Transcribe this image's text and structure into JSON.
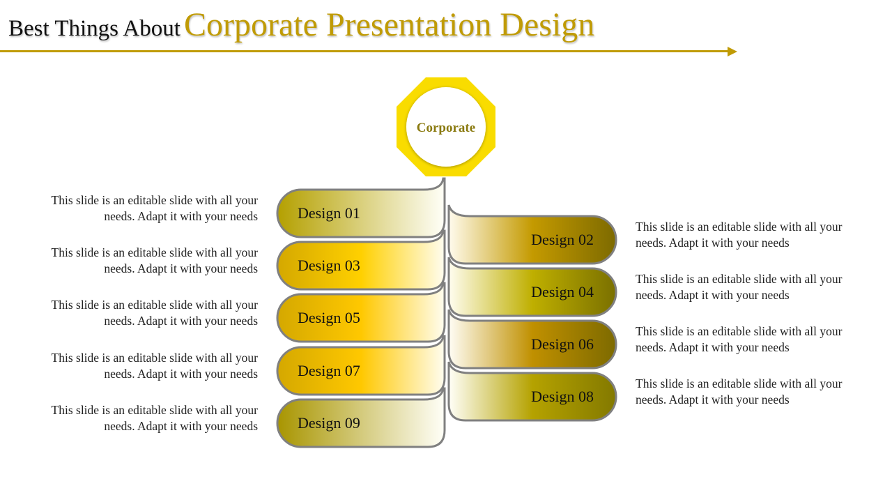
{
  "title": {
    "prefix": "Best Things About",
    "highlight": "Corporate Presentation Design"
  },
  "hub": {
    "label": "Corporate",
    "color": "#F9DC00"
  },
  "colors": {
    "accent": "#C09B05",
    "outline": "#808080"
  },
  "designs": [
    {
      "label": "Design 01",
      "side": "left",
      "gradient": [
        "#B4A000",
        "#FFFFF8"
      ]
    },
    {
      "label": "Design 02",
      "side": "right",
      "gradient": [
        "#FFFBEE",
        "#C49A00",
        "#7D6A00"
      ]
    },
    {
      "label": "Design 03",
      "side": "left",
      "gradient": [
        "#D4A800",
        "#FFD000",
        "#FFFDF0"
      ]
    },
    {
      "label": "Design 04",
      "side": "right",
      "gradient": [
        "#FFFDF0",
        "#BFAF00",
        "#7A7000"
      ]
    },
    {
      "label": "Design 05",
      "side": "left",
      "gradient": [
        "#D4A800",
        "#FFC800",
        "#FFFDF0"
      ]
    },
    {
      "label": "Design 06",
      "side": "right",
      "gradient": [
        "#FFFDF5",
        "#C09000",
        "#7D6A00"
      ]
    },
    {
      "label": "Design 07",
      "side": "left",
      "gradient": [
        "#D4A800",
        "#FFC800",
        "#FFFDF0"
      ]
    },
    {
      "label": "Design 08",
      "side": "right",
      "gradient": [
        "#FFFFF8",
        "#B5A200",
        "#837900"
      ]
    },
    {
      "label": "Design 09",
      "side": "left",
      "gradient": [
        "#A89500",
        "#FFFFF8"
      ]
    }
  ],
  "descriptions": {
    "left": [
      "This slide is an editable slide with all your needs. Adapt it with your needs",
      "This slide is an editable slide with all your needs. Adapt it with your needs",
      "This slide is an editable slide with all your needs. Adapt it with your needs",
      "This slide is an editable slide with all your needs. Adapt it with your needs",
      "This slide is an editable slide with all your needs. Adapt it with your needs"
    ],
    "right": [
      "This slide is an editable slide with all your needs. Adapt it with your needs",
      "This slide is an editable slide with all your needs. Adapt it with your needs",
      "This slide is an editable slide with all your needs. Adapt it with your needs",
      "This slide is an editable slide with all your needs. Adapt it with your needs"
    ]
  }
}
